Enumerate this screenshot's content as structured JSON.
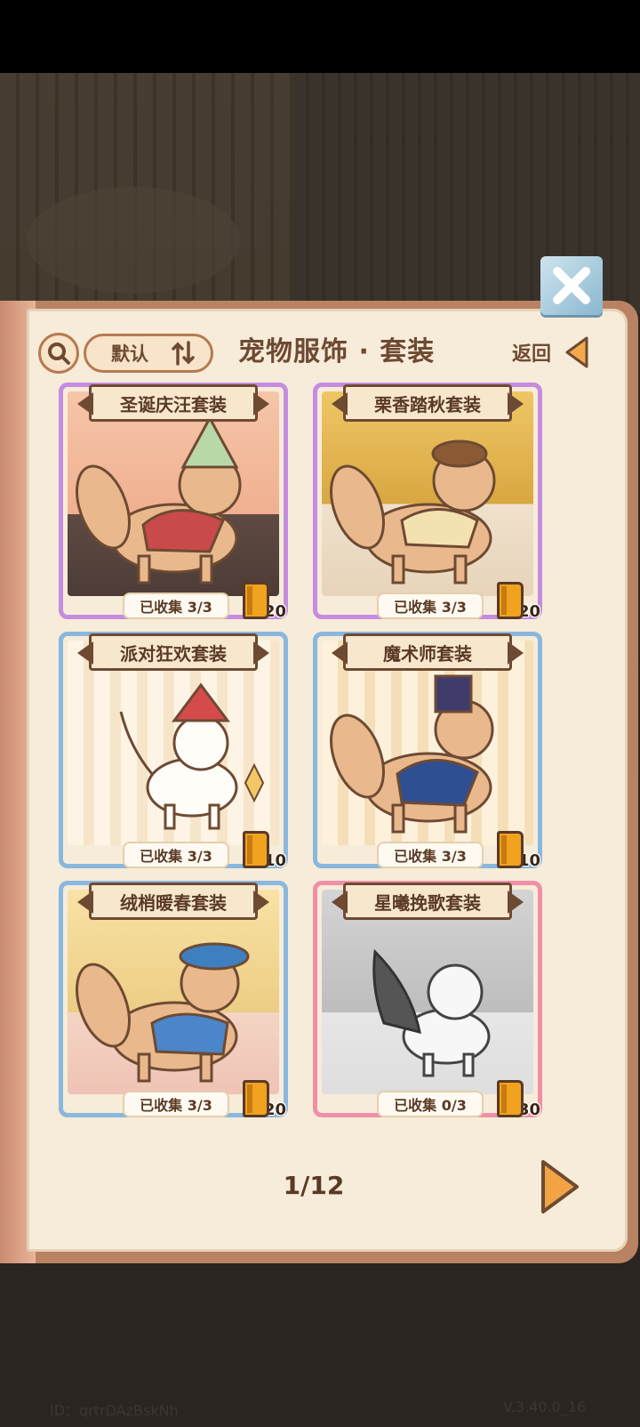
{
  "header": {
    "sort_label": "默认",
    "title": "宠物服饰 · 套装",
    "back_label": "返回"
  },
  "icons": {
    "search": "search-icon",
    "sort": "sort-icon",
    "back": "back-arrow-icon",
    "close": "close-icon",
    "next": "next-page-arrow-icon",
    "cost": "book-icon"
  },
  "sets": [
    {
      "name": "圣诞庆汪套装",
      "progress": "已收集 3/3",
      "cost": "20",
      "frame": "#c58ce0",
      "bg": "#f3b89c"
    },
    {
      "name": "栗香踏秋套装",
      "progress": "已收集 3/3",
      "cost": "20",
      "frame": "#c58ce0",
      "bg": "#e8c56c"
    },
    {
      "name": "派对狂欢套装",
      "progress": "已收集 3/3",
      "cost": "10",
      "frame": "#8ab7dd",
      "bg": "#fbeee0"
    },
    {
      "name": "魔术师套装",
      "progress": "已收集 3/3",
      "cost": "10",
      "frame": "#8ab7dd",
      "bg": "#fbe9cf"
    },
    {
      "name": "绒梢暖春套装",
      "progress": "已收集 3/3",
      "cost": "20",
      "frame": "#8ab7dd",
      "bg": "#f7dca0"
    },
    {
      "name": "星曦挽歌套装",
      "progress": "已收集 0/3",
      "cost": "30",
      "frame": "#ef8fa8",
      "bg": "#c9c9c9"
    }
  ],
  "pagination": {
    "label": "1/12"
  },
  "footer": {
    "id": "ID：qrtrDAzBskNh",
    "version": "V.3.40.0_16"
  }
}
